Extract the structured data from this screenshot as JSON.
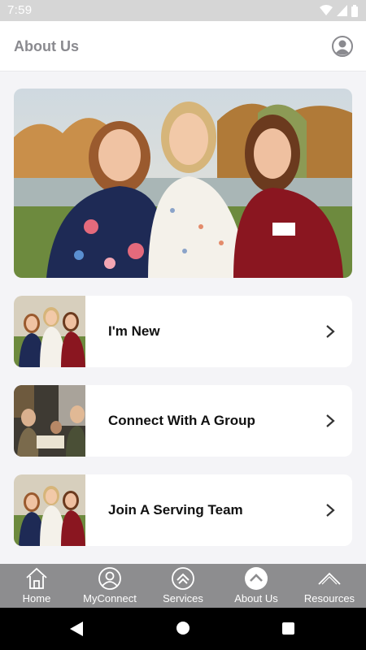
{
  "status_bar": {
    "time": "7:59"
  },
  "header": {
    "title": "About Us"
  },
  "cards": [
    {
      "label": "I'm New"
    },
    {
      "label": "Connect With A Group"
    },
    {
      "label": "Join A Serving Team"
    }
  ],
  "bottom_nav": [
    {
      "label": "Home",
      "icon": "home-icon"
    },
    {
      "label": "MyConnect",
      "icon": "person-icon"
    },
    {
      "label": "Services",
      "icon": "chevron-circle-icon"
    },
    {
      "label": "About Us",
      "icon": "chevron-circle-filled-icon",
      "active": true
    },
    {
      "label": "Resources",
      "icon": "chevron-up-icon"
    }
  ],
  "colors": {
    "nav_bg": "#8d8d8f",
    "page_bg": "#f4f4f7",
    "title_gray": "#8a8a8f"
  }
}
